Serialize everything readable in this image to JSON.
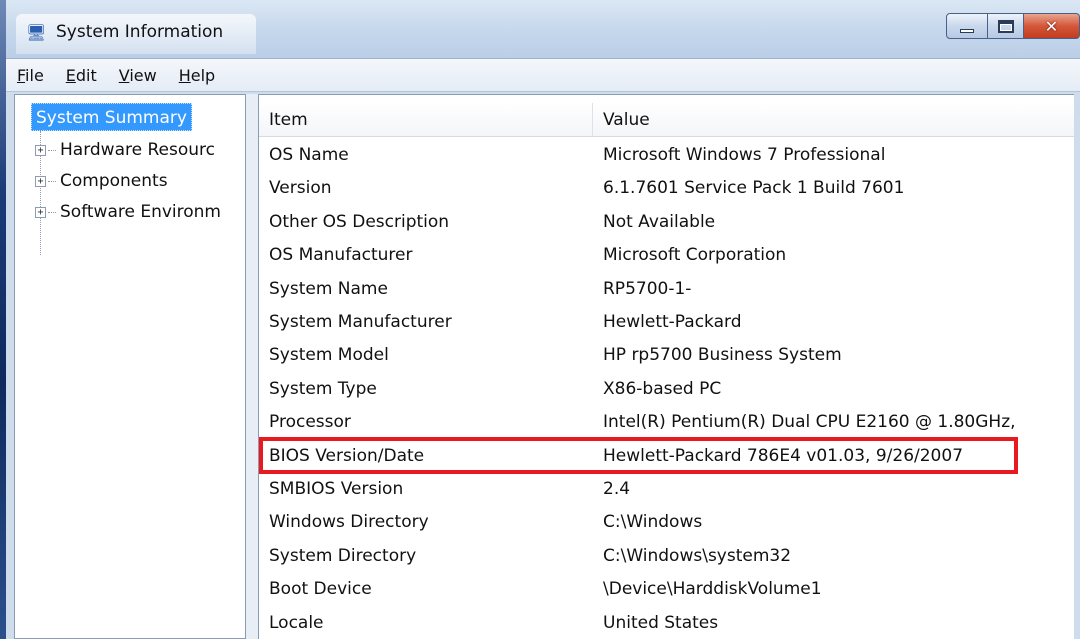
{
  "window": {
    "title": "System Information",
    "icon": "system-info-icon",
    "controls": [
      "minimize-icon",
      "maximize-icon",
      "close-icon"
    ]
  },
  "menu": [
    {
      "label": "File",
      "accel": "F",
      "rest": "ile"
    },
    {
      "label": "Edit",
      "accel": "E",
      "rest": "dit"
    },
    {
      "label": "View",
      "accel": "V",
      "rest": "iew"
    },
    {
      "label": "Help",
      "accel": "H",
      "rest": "elp"
    }
  ],
  "tree": {
    "selected": "System Summary",
    "children": [
      "Hardware Resourc",
      "Components",
      "Software Environm"
    ]
  },
  "list": {
    "columns": {
      "item": "Item",
      "value": "Value"
    },
    "rows": [
      {
        "item": "OS Name",
        "value": "Microsoft Windows 7 Professional"
      },
      {
        "item": "Version",
        "value": "6.1.7601 Service Pack 1 Build 7601"
      },
      {
        "item": "Other OS Description",
        "value": "Not Available"
      },
      {
        "item": "OS Manufacturer",
        "value": "Microsoft Corporation"
      },
      {
        "item": "System Name",
        "value": "RP5700-1-"
      },
      {
        "item": "System Manufacturer",
        "value": "Hewlett-Packard"
      },
      {
        "item": "System Model",
        "value": "HP rp5700 Business System"
      },
      {
        "item": "System Type",
        "value": "X86-based PC"
      },
      {
        "item": "Processor",
        "value": "Intel(R) Pentium(R) Dual  CPU  E2160  @ 1.80GHz,"
      },
      {
        "item": "BIOS Version/Date",
        "value": "Hewlett-Packard 786E4 v01.03, 9/26/2007"
      },
      {
        "item": "SMBIOS Version",
        "value": "2.4"
      },
      {
        "item": "Windows Directory",
        "value": "C:\\Windows"
      },
      {
        "item": "System Directory",
        "value": "C:\\Windows\\system32"
      },
      {
        "item": "Boot Device",
        "value": "\\Device\\HarddiskVolume1"
      },
      {
        "item": "Locale",
        "value": "United States"
      }
    ],
    "highlighted_item": "BIOS Version/Date",
    "highlight_color": "#e8191f"
  },
  "colors": {
    "selection": "#3399ff",
    "titlebar": "#c4d6ec"
  }
}
